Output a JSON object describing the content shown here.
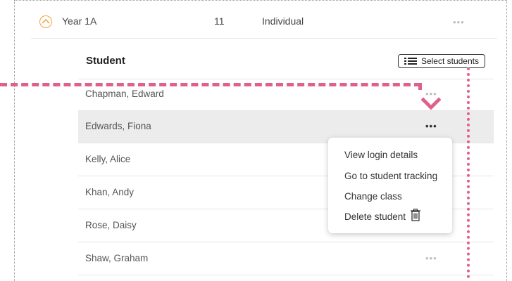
{
  "class_row": {
    "name": "Year 1A",
    "count": "11",
    "type": "Individual",
    "more": "•••"
  },
  "student_section": {
    "header": "Student",
    "select_button": "Select students"
  },
  "students": [
    {
      "name": "Chapman, Edward",
      "more": "•••"
    },
    {
      "name": "Edwards, Fiona",
      "more": "•••"
    },
    {
      "name": "Kelly, Alice"
    },
    {
      "name": "Khan, Andy"
    },
    {
      "name": "Rose, Daisy"
    },
    {
      "name": "Shaw, Graham",
      "more": "•••"
    }
  ],
  "context_menu": {
    "items": [
      "View login details",
      "Go to student tracking",
      "Change class",
      "Delete student"
    ]
  },
  "colors": {
    "accent_orange": "#f0a040",
    "highlight_pink": "#e0608a",
    "row_highlight": "#ececec"
  },
  "icons": [
    "chevron-up-circle-icon",
    "list-icon",
    "more-dots-icon",
    "trash-icon",
    "down-arrow-icon"
  ]
}
